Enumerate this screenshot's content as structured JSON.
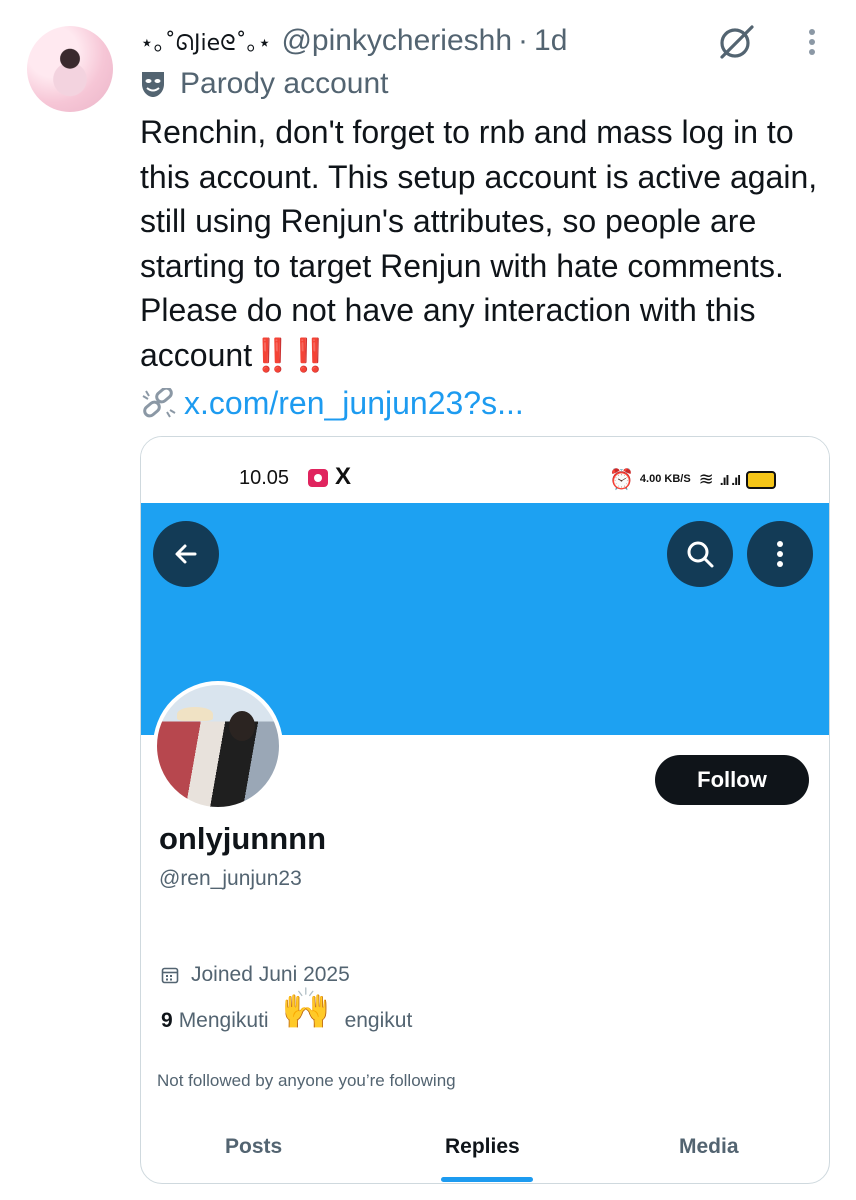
{
  "tweet": {
    "display_name": "⋆｡˚ᘏJieᘓ˚｡⋆",
    "handle": "@pinkycherieshh",
    "separator": "·",
    "time": "1d",
    "parody_label": "Parody account",
    "text": "Renchin, don't forget to rnb and mass log in to this account. This setup account is active again, still using Renjun's attributes, so people are starting to target Renjun with hate comments. Please do not have any interaction with this account",
    "text_emphasis": "‼️‼️",
    "link": "x.com/ren_junjun23?s..."
  },
  "screenshot": {
    "status_time": "10.05",
    "status_app": "X",
    "status_speed": "4.00 KB/S",
    "profile": {
      "name": "onlyjunnnn",
      "handle": "@ren_junjun23",
      "joined": "Joined Juni 2025",
      "following_count": "9",
      "following_label": "Mengikuti",
      "followers_label": "engikut",
      "not_followed": "Not followed by anyone you’re following",
      "follow_button": "Follow"
    },
    "tabs": [
      "Posts",
      "Replies",
      "Media"
    ],
    "active_tab": "Replies",
    "banner_color": "#1da1f2"
  },
  "icons": [
    "grok-icon",
    "more-icon",
    "parody-mask-icon",
    "broken-link-icon",
    "back-arrow-icon",
    "search-icon",
    "more-vertical-icon",
    "calendar-icon",
    "clap-emoji"
  ],
  "colors": {
    "link": "#1d9bf0",
    "text": "#0f1419",
    "muted": "#536471"
  }
}
